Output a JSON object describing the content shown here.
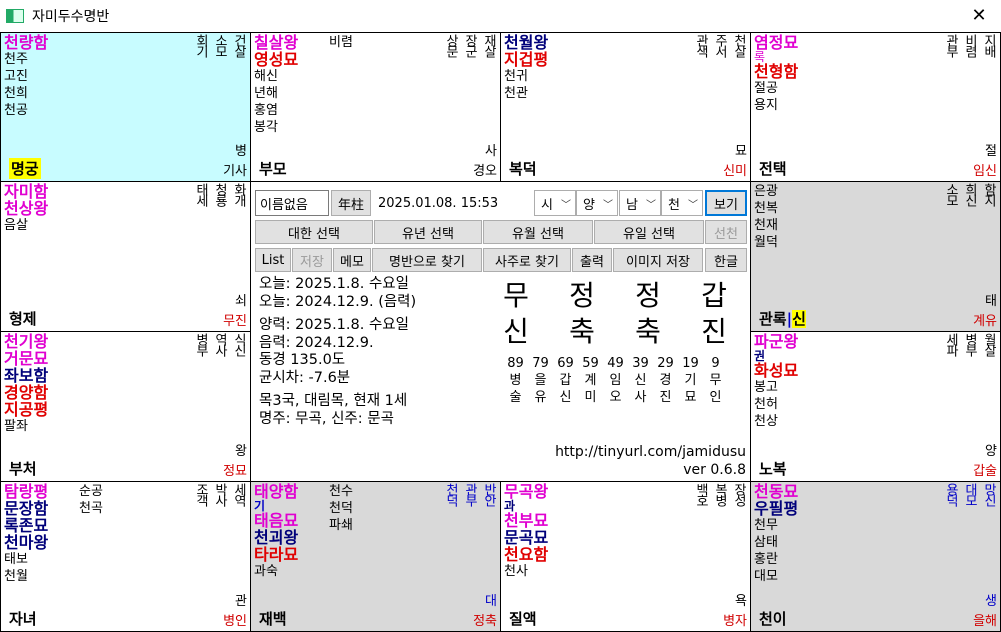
{
  "window": {
    "title": "자미두수명반",
    "close": "✕"
  },
  "cells": {
    "c11": {
      "left": [
        "천량함",
        "천주",
        "고진",
        "천희",
        "천공"
      ],
      "right": [
        "건살",
        "소모",
        "회기"
      ],
      "label": "병",
      "stem": "기사",
      "name": "명궁"
    },
    "c12": {
      "left": [
        "칠살왕",
        "영성묘",
        "해신",
        "년해",
        "홍염",
        "봉각"
      ],
      "mid": "비렴",
      "right": [
        "재살",
        "장군",
        "상문"
      ],
      "label": "사",
      "stem": "경오",
      "name": "부모"
    },
    "c13": {
      "left": [
        "천월왕",
        "지겁평",
        "천귀",
        "천관"
      ],
      "right": [
        "천살",
        "주서",
        "관색"
      ],
      "label": "묘",
      "stem": "신미",
      "name": "복덕"
    },
    "c14": {
      "left": [
        "염정묘",
        "록",
        "천형함",
        "절공",
        "용지"
      ],
      "right": [
        "지배",
        "비렴",
        "관부"
      ],
      "label": "절",
      "stem": "임신",
      "name": "전택"
    },
    "c21": {
      "left": [
        "자미함",
        "천상왕",
        "음살"
      ],
      "right": [
        "화개",
        "청룡",
        "태세"
      ],
      "label": "쇠",
      "stem": "무진",
      "name": "형제"
    },
    "c24": {
      "left": [
        "은광",
        "천복",
        "천재",
        "월덕"
      ],
      "right": [
        "함지",
        "희신",
        "소모"
      ],
      "label": "태",
      "stem": "계유",
      "name": "관록",
      "extra": "신"
    },
    "c31": {
      "left": [
        "천기왕",
        "거문묘",
        "좌보함",
        "경양함",
        "지공평",
        "팔좌"
      ],
      "right": [
        "식신",
        "역사",
        "병부"
      ],
      "label": "왕",
      "stem": "정묘",
      "name": "부처"
    },
    "c34": {
      "left": [
        "파군왕",
        "권",
        "화성묘",
        "봉고",
        "천허",
        "천상"
      ],
      "right": [
        "월살",
        "병부",
        "세파"
      ],
      "label": "양",
      "stem": "갑술",
      "name": "노복"
    },
    "c41": {
      "left": [
        "탐랑평",
        "문장함",
        "록존묘",
        "천마왕",
        "태보",
        "천월"
      ],
      "mid": [
        "순공",
        "천곡"
      ],
      "right": [
        "세역",
        "박사",
        "조객"
      ],
      "label": "관",
      "stem": "병인",
      "name": "자녀"
    },
    "c42": {
      "left": [
        "태양함",
        "기",
        "태음묘",
        "천괴왕",
        "타라묘",
        "과숙"
      ],
      "mid": [
        "천수",
        "천덕",
        "파쇄"
      ],
      "right": [
        "반안",
        "관부",
        "천덕"
      ],
      "label": "대",
      "stem": "정축",
      "name": "재백"
    },
    "c43": {
      "left": [
        "무곡왕",
        "과",
        "천부묘",
        "문곡묘",
        "천요함",
        "천사"
      ],
      "right": [
        "장성",
        "복병",
        "백호"
      ],
      "label": "욕",
      "stem": "병자",
      "name": "질액"
    },
    "c44": {
      "left": [
        "천동묘",
        "우필평",
        "천무",
        "삼태",
        "홍란",
        "대모"
      ],
      "right": [
        "망신",
        "대모",
        "용덕"
      ],
      "label": "생",
      "stem": "을해",
      "name": "천이"
    }
  },
  "center": {
    "name_value": "이름없음",
    "year_pillar_btn": "年柱",
    "datetime": "2025.01.08. 15:53",
    "sel1": "시",
    "sel2": "양",
    "sel3": "남",
    "sel4": "천",
    "view_btn": "보기",
    "row2": [
      "대한 선택",
      "유년 선택",
      "유월 선택",
      "유일 선택",
      "선천"
    ],
    "row3": [
      "List",
      "저장",
      "메모",
      "명반으로 찾기",
      "사주로 찾기",
      "출력",
      "이미지 저장",
      "한글"
    ],
    "info": [
      "오늘: 2025.1.8. 수요일",
      "오늘: 2024.12.9. (음력)",
      "",
      "양력: 2025.1.8. 수요일",
      "음력: 2024.12.9.",
      "동경 135.0도",
      "균시차: -7.6분",
      "",
      "목3국, 대림목, 현재 1세",
      "명주: 무곡, 신주: 문곡"
    ],
    "gan": [
      "무",
      "정",
      "정",
      "갑"
    ],
    "ji": [
      "신",
      "축",
      "축",
      "진"
    ],
    "daeun_ages": [
      "89",
      "79",
      "69",
      "59",
      "49",
      "39",
      "29",
      "19",
      "9"
    ],
    "daeun_gan": [
      "병",
      "을",
      "갑",
      "계",
      "임",
      "신",
      "경",
      "기",
      "무"
    ],
    "daeun_ji": [
      "술",
      "유",
      "신",
      "미",
      "오",
      "사",
      "진",
      "묘",
      "인"
    ],
    "url": "http://tinyurl.com/jamidusu",
    "version": "ver 0.6.8"
  },
  "colors": {
    "cyan": "#c8fcff",
    "gray": "#d9d9d9",
    "magenta": "#e000d0",
    "red": "#e00000",
    "blue": "#0000c8",
    "highlight": "#ffff00"
  }
}
